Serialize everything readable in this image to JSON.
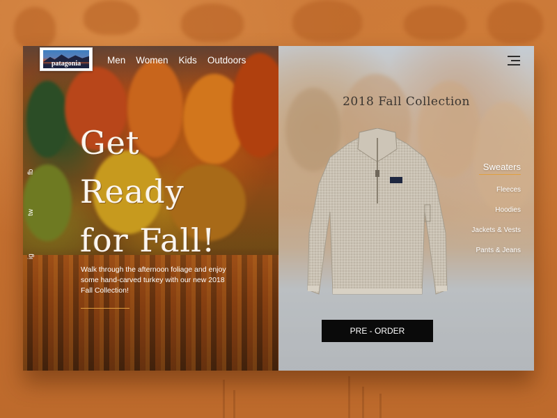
{
  "brand": {
    "logo_text": "patagonia"
  },
  "nav": {
    "items": [
      "Men",
      "Women",
      "Kids",
      "Outdoors"
    ]
  },
  "social": {
    "items": [
      "fb",
      "tw",
      "ig"
    ]
  },
  "hero": {
    "headline_lines": [
      "Get",
      "Ready",
      "for Fall!"
    ],
    "body": "Walk through the afternoon foliage and enjoy some hand-carved turkey with our new 2018 Fall Collection!"
  },
  "collection": {
    "title": "2018 Fall Collection",
    "categories": [
      {
        "label": "Sweaters",
        "active": true
      },
      {
        "label": "Fleeces",
        "active": false
      },
      {
        "label": "Hoodies",
        "active": false
      },
      {
        "label": "Jackets & Vests",
        "active": false
      },
      {
        "label": "Pants & Jeans",
        "active": false
      }
    ],
    "cta_label": "PRE - ORDER"
  },
  "icons": {
    "menu": "hamburger-menu-icon",
    "product": "sweater-product-image"
  },
  "colors": {
    "accent": "#e0a040",
    "button": "#0a0a0a",
    "background": "#c46f2f"
  }
}
